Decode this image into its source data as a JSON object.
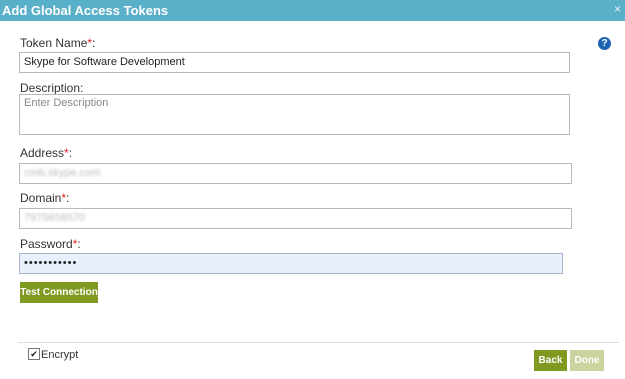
{
  "dialog": {
    "title": "Add Global Access Tokens",
    "close_icon": "×",
    "help_icon": "?"
  },
  "form": {
    "token_name": {
      "label": "Token Name",
      "required_mark": "*",
      "colon": ":",
      "value": "Skype for Software Development"
    },
    "description": {
      "label": "Description:",
      "placeholder": "Enter Description"
    },
    "address": {
      "label": "Address",
      "required_mark": "*",
      "colon": ":",
      "value": "cmb.skype.com"
    },
    "domain": {
      "label": "Domain",
      "required_mark": "*",
      "colon": ":",
      "value": "7975658570"
    },
    "password": {
      "label": "Password",
      "required_mark": "*",
      "colon": ":",
      "value": "•••••••••••"
    }
  },
  "buttons": {
    "test_connection": "Test Connection",
    "back": "Back",
    "done": "Done"
  },
  "footer": {
    "encrypt_label": "Encrypt",
    "encrypt_checked": true,
    "check_glyph": "✔"
  },
  "colors": {
    "title_bar": "#5aafc9",
    "primary_button": "#7f9a21",
    "disabled_button": "#c9d49e",
    "required": "#d8261c",
    "help_icon": "#1f64b3"
  }
}
